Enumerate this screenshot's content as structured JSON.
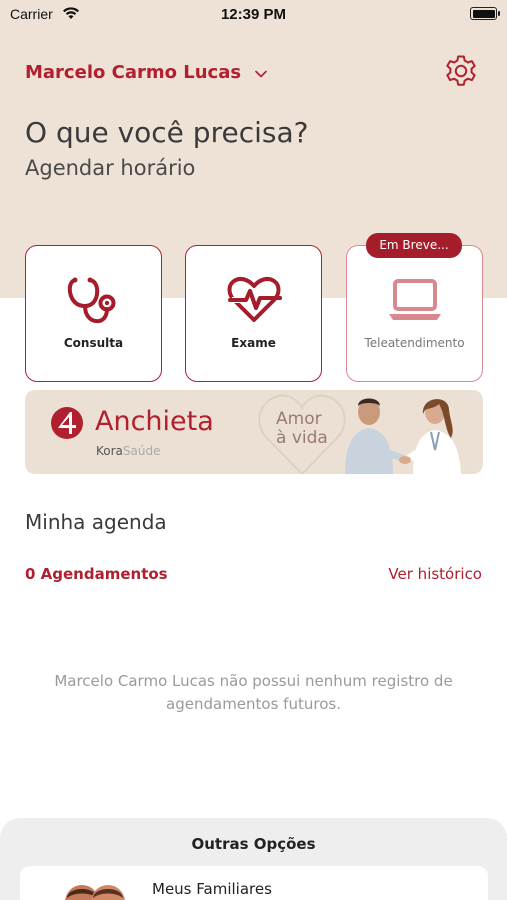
{
  "status_bar": {
    "carrier": "Carrier",
    "time": "12:39 PM"
  },
  "header": {
    "user_name": "Marcelo Carmo Lucas",
    "settings_icon": "gear-icon"
  },
  "hero": {
    "title": "O que você precisa?",
    "subtitle": "Agendar horário"
  },
  "services": [
    {
      "label": "Consulta",
      "icon": "stethoscope-icon"
    },
    {
      "label": "Exame",
      "icon": "heart-pulse-icon"
    },
    {
      "label": "Teleatendimento",
      "icon": "laptop-icon",
      "badge": "Em Breve..."
    }
  ],
  "banner": {
    "brand": "Anchieta",
    "sub_bold": "Kora",
    "sub_light": "Saúde",
    "tagline_1": "Amor",
    "tagline_2": "à vida"
  },
  "agenda": {
    "title": "Minha agenda",
    "count_label": "0 Agendamentos",
    "history_link": "Ver histórico",
    "empty_message": "Marcelo Carmo Lucas não possui nenhum registro de agendamentos futuros."
  },
  "other_options": {
    "title": "Outras Opções",
    "items": [
      {
        "label": "Meus Familiares",
        "icon": "family-icon"
      }
    ]
  },
  "colors": {
    "accent": "#b0202e",
    "hero_bg": "#eee2d7",
    "badge_bg": "#a51c2b"
  }
}
